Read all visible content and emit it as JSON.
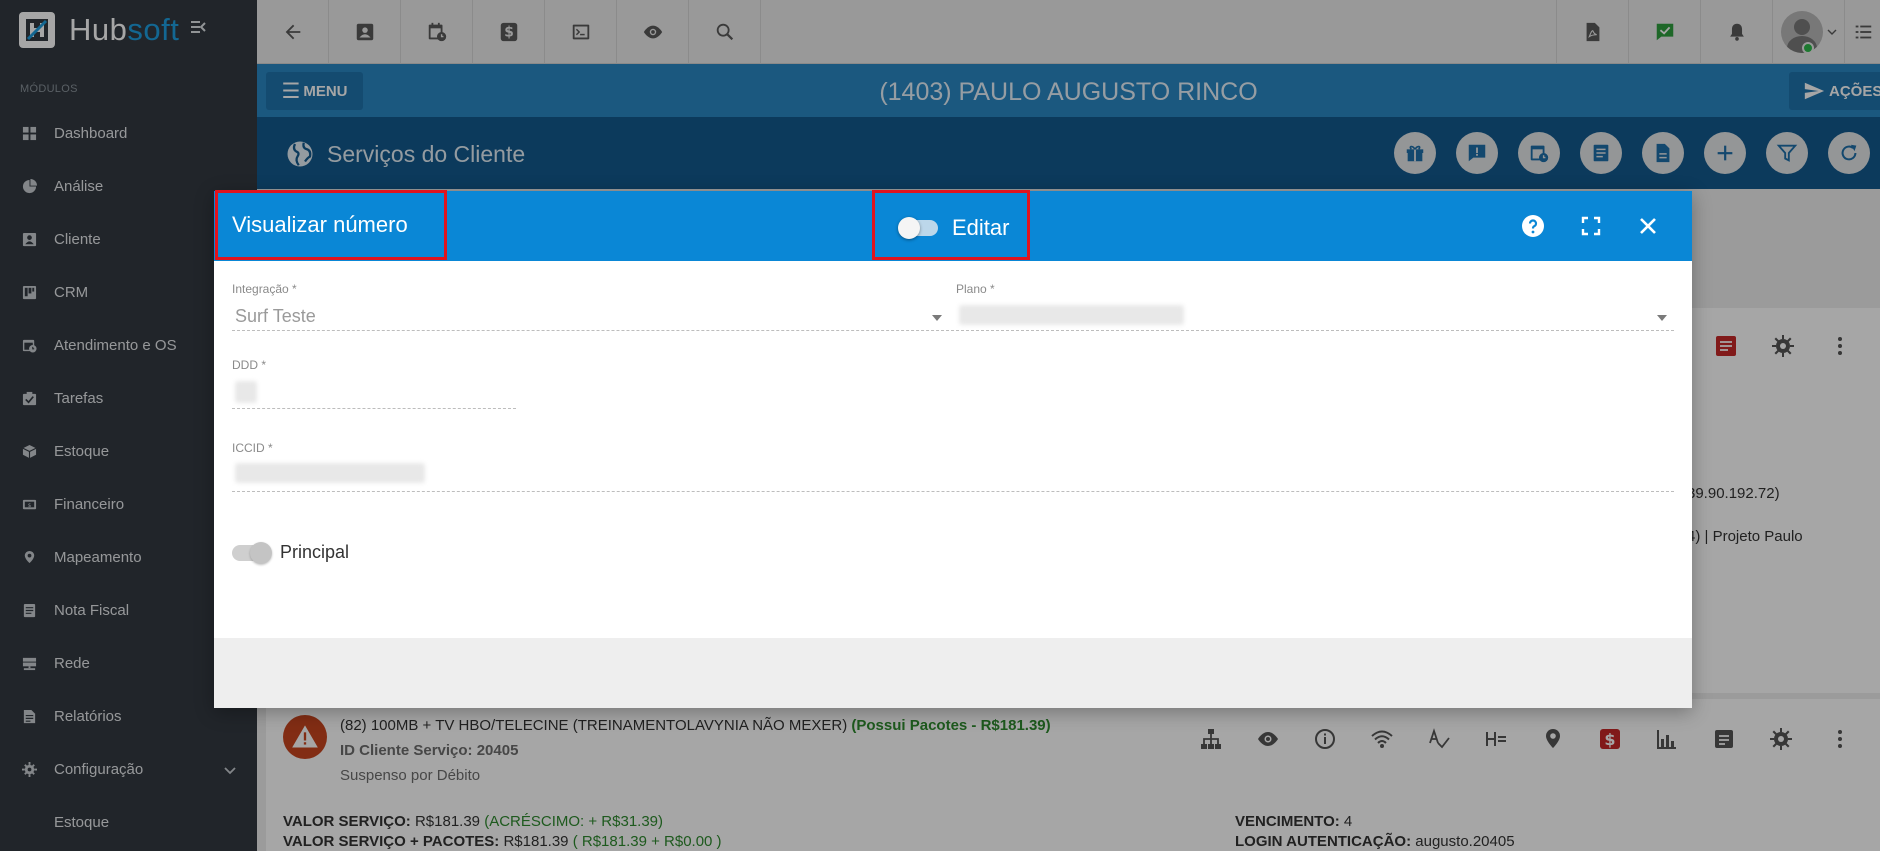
{
  "app": {
    "logo_prefix": "Hub",
    "logo_suffix": "soft"
  },
  "sidebar": {
    "section_label": "MÓDULOS",
    "items": [
      {
        "label": "Dashboard",
        "icon": "dashboard-icon"
      },
      {
        "label": "Análise",
        "icon": "pie-chart-icon"
      },
      {
        "label": "Cliente",
        "icon": "contact-card-icon"
      },
      {
        "label": "CRM",
        "icon": "kanban-icon"
      },
      {
        "label": "Atendimento e OS",
        "icon": "calendar-clock-icon"
      },
      {
        "label": "Tarefas",
        "icon": "tasks-icon"
      },
      {
        "label": "Estoque",
        "icon": "box-icon"
      },
      {
        "label": "Financeiro",
        "icon": "money-icon"
      },
      {
        "label": "Mapeamento",
        "icon": "map-pin-icon"
      },
      {
        "label": "Nota Fiscal",
        "icon": "invoice-icon"
      },
      {
        "label": "Rede",
        "icon": "server-icon"
      },
      {
        "label": "Relatórios",
        "icon": "report-icon"
      },
      {
        "label": "Configuração",
        "icon": "gear-icon"
      }
    ],
    "sub_item": "Estoque"
  },
  "client_bar": {
    "menu_label": "MENU",
    "client_name": "(1403) PAULO AUGUSTO RINCO",
    "actions_label": "AÇÕES"
  },
  "services_bar": {
    "title": "Serviços do Cliente"
  },
  "background": {
    "ip_fragment": "39.90.192.72)",
    "project_fragment": "4) | Projeto Paulo",
    "service2": {
      "title": "(82) 100MB + TV HBO/TELECINE (TREINAMENTOLAVYNIA NÃO MEXER)",
      "packages": "(Possui Pacotes - R$181.39)",
      "client_id": "ID Cliente Serviço: 20405",
      "status": "Suspenso por Débito",
      "valor_label": "VALOR SERVIÇO:",
      "valor_value": "R$181.39",
      "valor_extra": "(ACRÉSCIMO: + R$31.39)",
      "valor_pacotes_label": "VALOR SERVIÇO + PACOTES:",
      "valor_pacotes_value": "R$181.39",
      "valor_pacotes_extra": "( R$181.39 + R$0.00 )",
      "vencimento_label": "VENCIMENTO:",
      "vencimento_value": "4",
      "login_label": "LOGIN AUTENTICAÇÃO:",
      "login_value": "augusto.20405"
    }
  },
  "modal": {
    "title": "Visualizar número",
    "edit_label": "Editar",
    "edit_on": false,
    "fields": {
      "integracao_label": "Integração *",
      "integracao_value": "Surf Teste",
      "plano_label": "Plano *",
      "ddd_label": "DDD *",
      "iccid_label": "ICCID *"
    },
    "principal_label": "Principal",
    "principal_on": true
  },
  "colors": {
    "modal_header": "#0a87d6",
    "client_bar": "#2a87c4",
    "services_bar": "#135a8e",
    "sidebar": "#333a41",
    "highlight": "#e0141e"
  }
}
